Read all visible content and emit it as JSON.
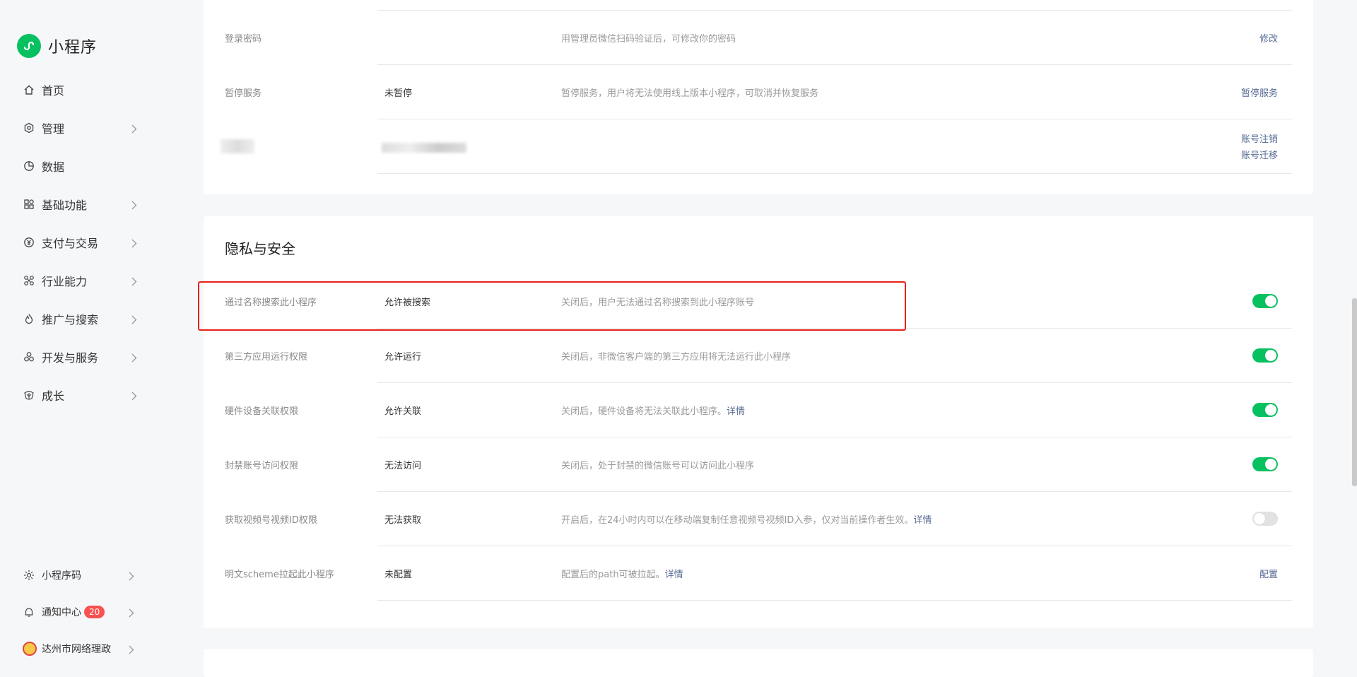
{
  "app": {
    "name": "小程序"
  },
  "sidebar": {
    "items": [
      {
        "label": "首页",
        "icon": "home-icon",
        "has_arrow": false
      },
      {
        "label": "管理",
        "icon": "manage-icon",
        "has_arrow": true
      },
      {
        "label": "数据",
        "icon": "data-icon",
        "has_arrow": false
      },
      {
        "label": "基础功能",
        "icon": "grid-icon",
        "has_arrow": true
      },
      {
        "label": "支付与交易",
        "icon": "yuan-icon",
        "has_arrow": true
      },
      {
        "label": "行业能力",
        "icon": "industry-icon",
        "has_arrow": true
      },
      {
        "label": "推广与搜索",
        "icon": "flame-icon",
        "has_arrow": true
      },
      {
        "label": "开发与服务",
        "icon": "dev-icon",
        "has_arrow": true
      },
      {
        "label": "成长",
        "icon": "growth-icon",
        "has_arrow": true
      }
    ],
    "footer": {
      "qrcode": {
        "label": "小程序码",
        "icon": "qrcode-icon"
      },
      "notifications": {
        "label": "通知中心",
        "badge": "20",
        "icon": "bell-icon"
      },
      "account": {
        "label": "达州市网络理政",
        "icon": "account-avatar"
      }
    }
  },
  "account_card": {
    "rows": [
      {
        "label": "登录密码",
        "value": "",
        "desc": "用管理员微信扫码验证后，可修改你的密码",
        "actions": [
          "修改"
        ]
      },
      {
        "label": "暂停服务",
        "value": "未暂停",
        "desc": "暂停服务，用户将无法使用线上版本小程序，可取消并恢复服务",
        "actions": [
          "暂停服务"
        ]
      },
      {
        "label": "",
        "value": "",
        "desc": "",
        "actions": [
          "账号注销",
          "账号迁移"
        ]
      }
    ]
  },
  "privacy": {
    "title": "隐私与安全",
    "rows": [
      {
        "label": "通过名称搜索此小程序",
        "value": "允许被搜索",
        "desc": "关闭后，用户无法通过名称搜索到此小程序账号",
        "link": "",
        "toggle": true
      },
      {
        "label": "第三方应用运行权限",
        "value": "允许运行",
        "desc": "关闭后，非微信客户端的第三方应用将无法运行此小程序",
        "link": "",
        "toggle": true
      },
      {
        "label": "硬件设备关联权限",
        "value": "允许关联",
        "desc": "关闭后，硬件设备将无法关联此小程序。",
        "link": "详情",
        "toggle": true
      },
      {
        "label": "封禁账号访问权限",
        "value": "无法访问",
        "desc": "关闭后，处于封禁的微信账号可以访问此小程序",
        "link": "",
        "toggle": true
      },
      {
        "label": "获取视频号视频ID权限",
        "value": "无法获取",
        "desc": "开启后，在24小时内可以在移动端复制任意视频号视频ID入参，仅对当前操作者生效。",
        "link": "详情",
        "toggle": false
      },
      {
        "label": "明文scheme拉起此小程序",
        "value": "未配置",
        "desc": "配置后的path可被拉起。",
        "link": "详情",
        "action": "配置"
      }
    ]
  },
  "colors": {
    "accent": "#07c160",
    "link": "#576b95",
    "highlight": "#e8211b",
    "badge": "#fa5151"
  }
}
